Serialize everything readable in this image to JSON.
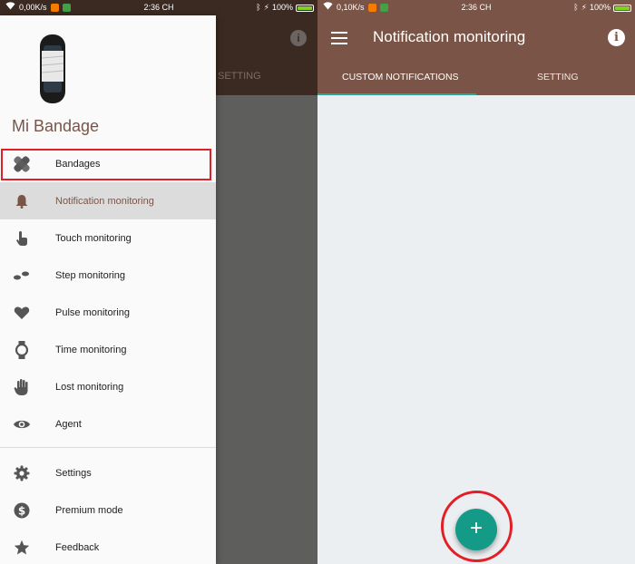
{
  "left_status": {
    "speed": "0,00K/s",
    "time": "2:36 CH",
    "battery": "100%"
  },
  "right_status": {
    "speed": "0,10K/s",
    "time": "2:36 CH",
    "battery": "100%"
  },
  "behind_drawer": {
    "tab_setting": "SETTING"
  },
  "drawer": {
    "title": "Mi Bandage",
    "items": [
      {
        "label": "Bandages",
        "icon": "bandage-icon"
      },
      {
        "label": "Notification monitoring",
        "icon": "bell-icon"
      },
      {
        "label": "Touch monitoring",
        "icon": "touch-icon"
      },
      {
        "label": "Step monitoring",
        "icon": "footsteps-icon"
      },
      {
        "label": "Pulse monitoring",
        "icon": "heart-icon"
      },
      {
        "label": "Time monitoring",
        "icon": "watch-icon"
      },
      {
        "label": "Lost monitoring",
        "icon": "hand-icon"
      },
      {
        "label": "Agent",
        "icon": "eye-icon"
      }
    ],
    "footer_items": [
      {
        "label": "Settings",
        "icon": "gear-icon"
      },
      {
        "label": "Premium mode",
        "icon": "dollar-icon"
      },
      {
        "label": "Feedback",
        "icon": "star-icon"
      }
    ]
  },
  "appbar": {
    "title": "Notification monitoring",
    "tabs": [
      "CUSTOM NOTIFICATIONS",
      "SETTING"
    ]
  },
  "fab": {
    "label": "+"
  },
  "colors": {
    "brown": "#7a5547",
    "dark_brown": "#3b2a22",
    "teal": "#139b87",
    "highlight_red": "#e21f26"
  }
}
